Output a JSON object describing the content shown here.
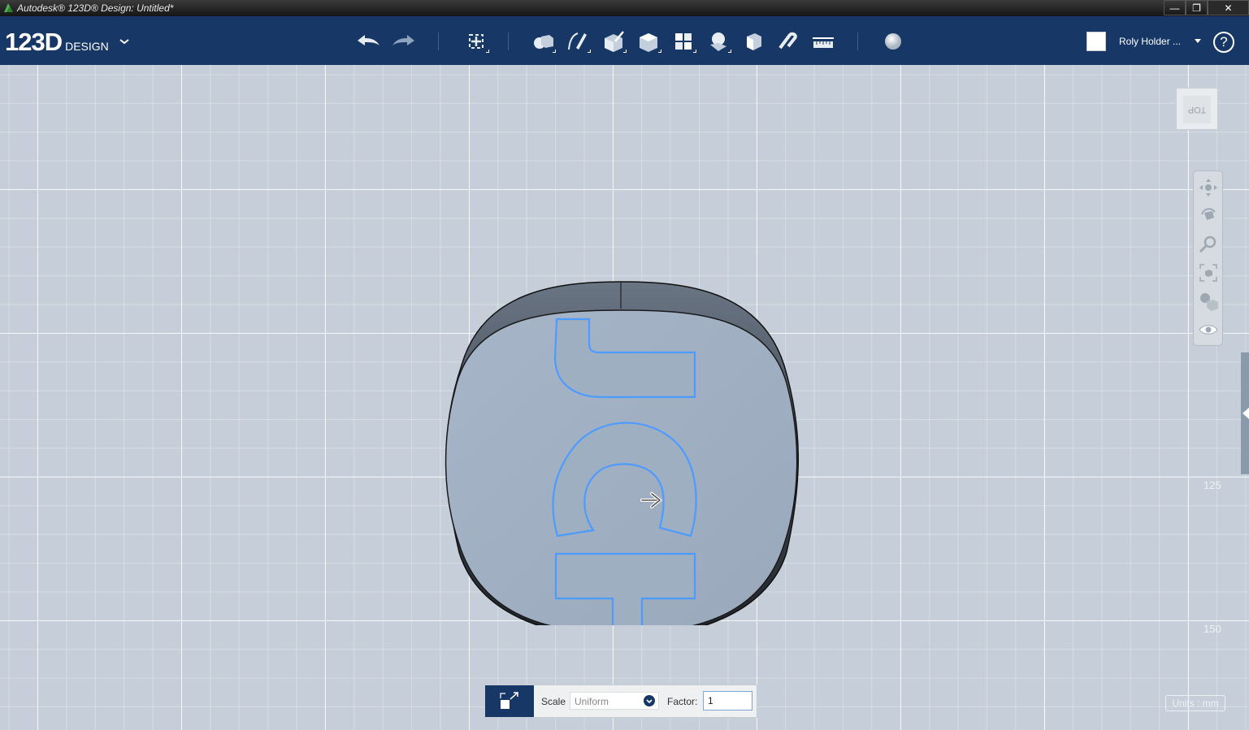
{
  "window": {
    "title": "Autodesk® 123D® Design: Untitled*",
    "controls": [
      "—",
      "❐",
      "✕"
    ]
  },
  "logo": {
    "number": "123D",
    "product": "DESIGN"
  },
  "toolbar": {
    "buttons": [
      "undo-icon",
      "redo-icon",
      "transform-icon",
      "primitives-icon",
      "sketch-icon",
      "construct-icon",
      "modify-icon",
      "pattern-icon",
      "group-icon",
      "combine-icon",
      "snap-icon",
      "measure-icon",
      "material-icon"
    ]
  },
  "user": {
    "name": "Roly Holder ..."
  },
  "help": {
    "label": "?"
  },
  "viewcube": {
    "face_label": "TOP"
  },
  "ruler": {
    "label_125": "125",
    "label_150": "150"
  },
  "units": {
    "label": "Units : mm"
  },
  "scale_panel": {
    "scale_label": "Scale",
    "scale_mode": "Uniform",
    "factor_label": "Factor:",
    "factor_value": "1"
  },
  "colors": {
    "toolbar": "#173866",
    "viewport": "#c6cfd9",
    "selection": "#4d9bff",
    "model_top": "#a0b1c3",
    "model_side": "#2e353d"
  }
}
